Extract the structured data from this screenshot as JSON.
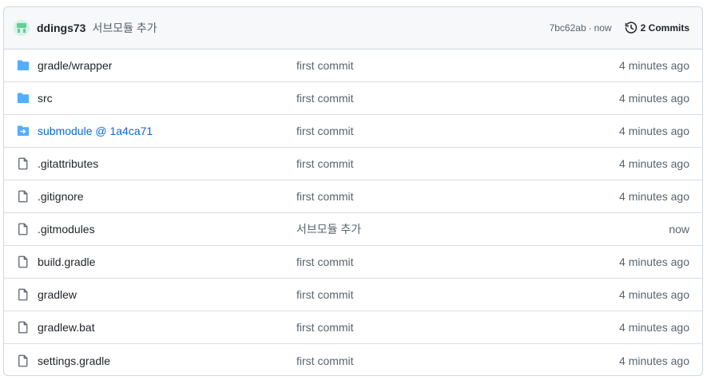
{
  "header": {
    "author": "ddings73",
    "message": "서브모듈 추가",
    "sha": "7bc62ab",
    "separator": "·",
    "time": "now",
    "commits_label": "2 Commits"
  },
  "colors": {
    "folder": "#54aeff",
    "file": "#59636e",
    "link": "#0969da",
    "avatar": "#5fcf9a"
  },
  "files": [
    {
      "name": "gradle/wrapper",
      "type": "folder",
      "message": "first commit",
      "age": "4 minutes ago"
    },
    {
      "name": "src",
      "type": "folder",
      "message": "first commit",
      "age": "4 minutes ago"
    },
    {
      "name": "submodule @ 1a4ca71",
      "type": "submodule",
      "message": "first commit",
      "age": "4 minutes ago"
    },
    {
      "name": ".gitattributes",
      "type": "file",
      "message": "first commit",
      "age": "4 minutes ago"
    },
    {
      "name": ".gitignore",
      "type": "file",
      "message": "first commit",
      "age": "4 minutes ago"
    },
    {
      "name": ".gitmodules",
      "type": "file",
      "message": "서브모듈 추가",
      "age": "now"
    },
    {
      "name": "build.gradle",
      "type": "file",
      "message": "first commit",
      "age": "4 minutes ago"
    },
    {
      "name": "gradlew",
      "type": "file",
      "message": "first commit",
      "age": "4 minutes ago"
    },
    {
      "name": "gradlew.bat",
      "type": "file",
      "message": "first commit",
      "age": "4 minutes ago"
    },
    {
      "name": "settings.gradle",
      "type": "file",
      "message": "first commit",
      "age": "4 minutes ago"
    }
  ]
}
